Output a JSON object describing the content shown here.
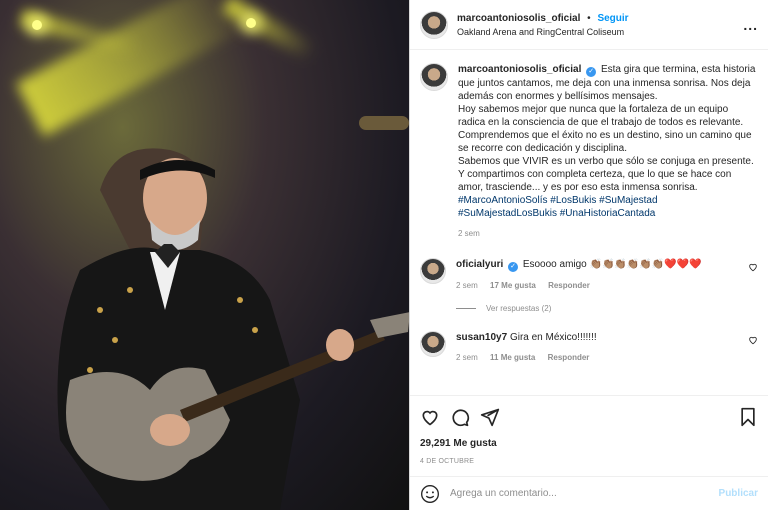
{
  "post": {
    "username": "marcoantoniosolis_oficial",
    "follow_label": "Seguir",
    "location": "Oakland Arena and RingCentral Coliseum",
    "separator": "•",
    "more_label": "..."
  },
  "caption": {
    "username": "marcoantoniosolis_oficial",
    "verified_mark": "✓",
    "line1": "Esta gira que termina, esta historia que juntos cantamos, me deja con una inmensa sonrisa. Nos deja además con enormes y bellísimos mensajes.",
    "line2": "Hoy sabemos mejor que nunca que la fortaleza de un equipo radica en la consciencia de que el trabajo de todos es relevante.",
    "line3": "Comprendemos que el éxito no es un destino, sino un camino que se recorre con dedicación y disciplina.",
    "line4": "Sabemos que VIVIR es un verbo que sólo se conjuga en presente.",
    "line5": "Y compartimos con completa certeza, que lo que se hace con amor, trasciende... y es por eso esta inmensa sonrisa.",
    "hashtags": "#MarcoAntonioSolís #LosBukis #SuMajestad #SuMajestadLosBukis #UnaHistoriaCantada",
    "time": "2 sem"
  },
  "comments": [
    {
      "username": "oficialyuri",
      "verified_mark": "✓",
      "text": "Esoooo amigo 👏🏽👏🏽👏🏽👏🏽👏🏽👏🏽❤️❤️❤️",
      "time": "2 sem",
      "likes": "17 Me gusta",
      "reply": "Responder",
      "view_replies": "Ver respuestas (2)"
    },
    {
      "username": "susan10y7",
      "text": "Gira en México!!!!!!!",
      "time": "2 sem",
      "likes": "11 Me gusta",
      "reply": "Responder"
    }
  ],
  "footer": {
    "likes": "29,291 Me gusta",
    "date": "4 DE OCTUBRE",
    "comment_placeholder": "Agrega un comentario...",
    "publish_label": "Publicar"
  },
  "colors": {
    "accent": "#0095f6",
    "link": "#00376b",
    "muted": "#8e8e8e",
    "publish_disabled": "#b2dffc"
  }
}
